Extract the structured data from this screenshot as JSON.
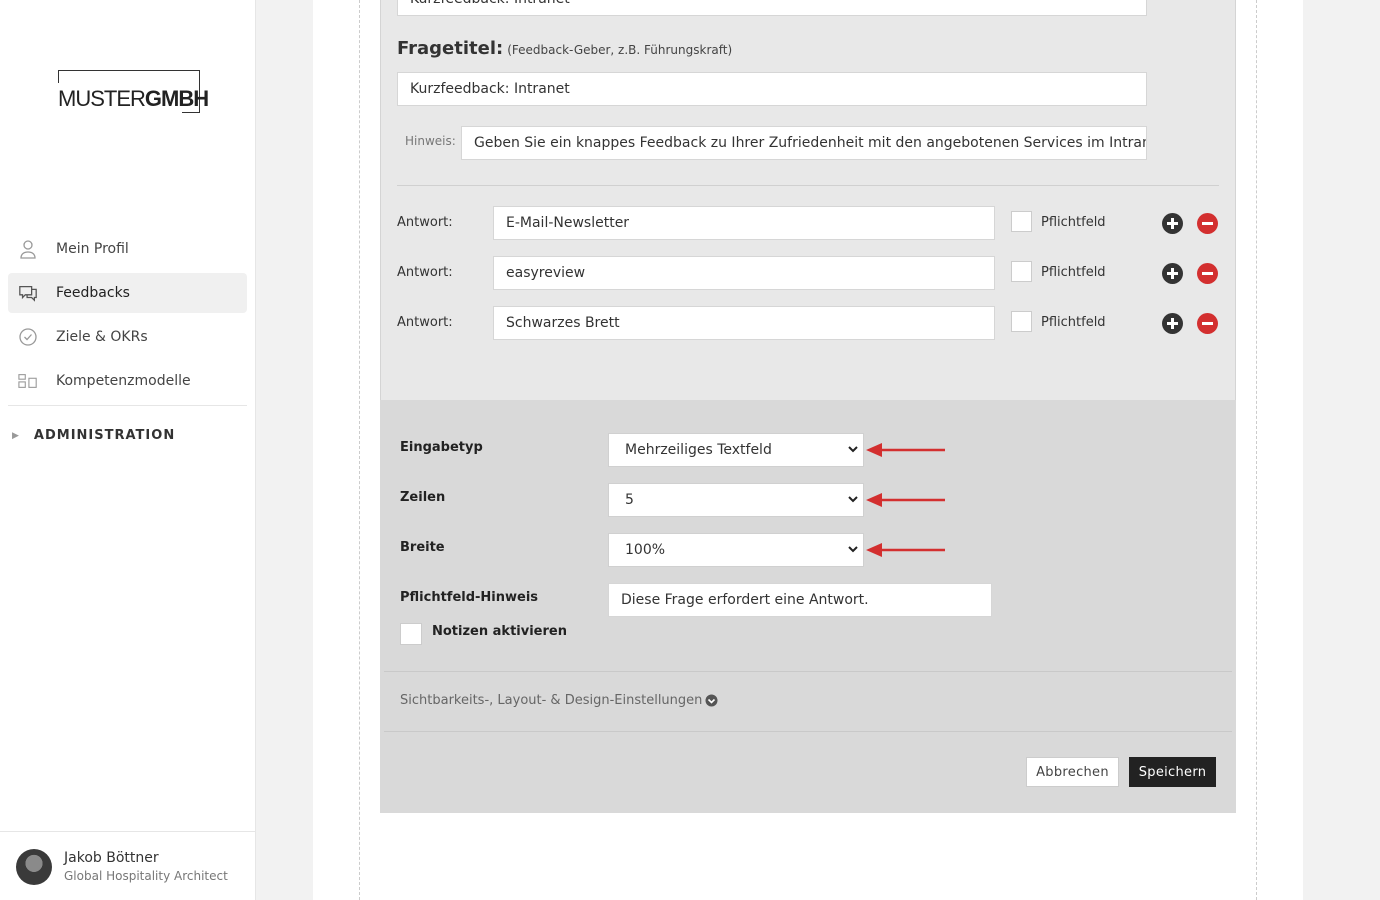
{
  "logo": {
    "part1": "MUSTER",
    "part2": "GMBH"
  },
  "nav": {
    "items": [
      {
        "label": "Mein Profil",
        "icon": "user-icon"
      },
      {
        "label": "Feedbacks",
        "icon": "chat-bubbles-icon",
        "active": true
      },
      {
        "label": "Ziele & OKRs",
        "icon": "check-circle-icon"
      },
      {
        "label": "Kompetenzmodelle",
        "icon": "blocks-icon"
      }
    ],
    "admin": "ADMINISTRATION"
  },
  "user": {
    "name": "Jakob Böttner",
    "role": "Global Hospitality Architect"
  },
  "form": {
    "top_field_value": "Kurzfeedback: Intranet",
    "fragetitel_label": "Fragetitel:",
    "fragetitel_hint": "(Feedback-Geber, z.B. Führungskraft)",
    "fragetitel_value": "Kurzfeedback: Intranet",
    "hinweis_label": "Hinweis:",
    "hinweis_value": "Geben Sie ein knappes Feedback zu Ihrer Zufriedenheit mit den angebotenen Services im Intranet",
    "answer_label": "Antwort:",
    "required_label": "Pflichtfeld",
    "answers": [
      "E-Mail-Newsletter",
      "easyreview",
      "Schwarzes Brett"
    ]
  },
  "settings": {
    "eingabetyp_label": "Eingabetyp",
    "eingabetyp_value": "Mehrzeiliges Textfeld",
    "zeilen_label": "Zeilen",
    "zeilen_value": "5",
    "breite_label": "Breite",
    "breite_value": "100%",
    "pflichtfeld_hinweis_label": "Pflichtfeld-Hinweis",
    "pflichtfeld_hinweis_value": "Diese Frage erfordert eine Antwort.",
    "notizen_label": "Notizen aktivieren",
    "design_link": "Sichtbarkeits-, Layout- & Design-Einstellungen"
  },
  "buttons": {
    "cancel": "Abbrechen",
    "save": "Speichern"
  },
  "colors": {
    "arrow": "#d32f2f",
    "minus": "#d32f2f",
    "plus": "#333333",
    "save_bg": "#222222"
  }
}
